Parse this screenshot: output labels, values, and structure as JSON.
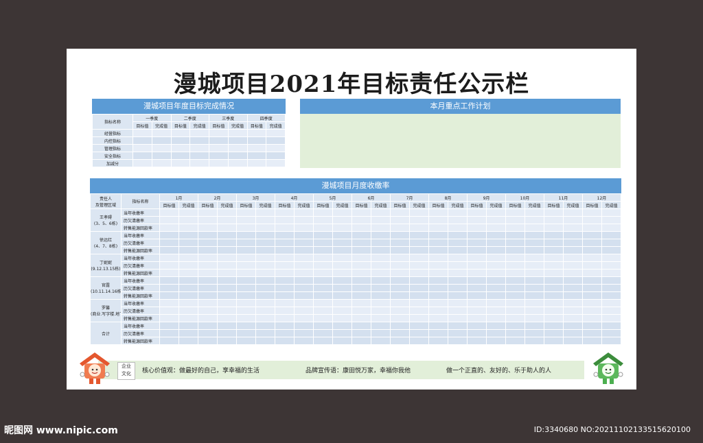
{
  "title": "漫城项目2021年目标责任公示栏",
  "annual": {
    "header": "漫城项目年度目标完成情况",
    "col_label": "指标名称",
    "quarters": [
      "一季度",
      "二季度",
      "三季度",
      "四季度"
    ],
    "target": "目标值",
    "done": "完成值",
    "rows": [
      "经营指标",
      "内控指标",
      "管理指标",
      "安全指标",
      "加减分"
    ]
  },
  "plan": {
    "header": "本月重点工作计划"
  },
  "monthly": {
    "header": "漫城项目月度收缴率",
    "col_person": "责任人",
    "col_area": "及管理区域",
    "col_label": "指标名称",
    "months": [
      "1月",
      "2月",
      "3月",
      "4月",
      "5月",
      "6月",
      "7月",
      "8月",
      "9月",
      "10月",
      "11月",
      "12月"
    ],
    "target": "目标值",
    "done": "完成值",
    "metrics": [
      "当年收缴率",
      "历欠清缴率",
      "转售能源回款率"
    ],
    "groups": [
      {
        "name": "王孝碍",
        "area": "(3、5、6栋)"
      },
      {
        "name": "徐远红",
        "area": "(4、7、8栋)"
      },
      {
        "name": "丁妮妮",
        "area": "(9.12.13.15栋)"
      },
      {
        "name": "官露",
        "area": "(10.11.14.16栋)"
      },
      {
        "name": "罗馨",
        "area": "(商业.写字楼.地下室)"
      },
      {
        "name": "合计",
        "area": ""
      }
    ]
  },
  "footer": {
    "culture_1": "企业",
    "culture_2": "文化",
    "values": "核心价值观：做最好的自己，享幸福的生活",
    "slogan": "品牌宣传语：康田悦万家，幸福你我他",
    "motto": "做一个正直的、友好的、乐于助人的人"
  },
  "watermark": {
    "left": "昵图网 www.nipic.com",
    "right": "ID:3340680 NO:20211102133515620100"
  },
  "colors": {
    "header_blue": "#5b9bd5",
    "plan_green": "#e2efd9",
    "mascot_red": "#e4572e",
    "mascot_green": "#4caf50"
  }
}
